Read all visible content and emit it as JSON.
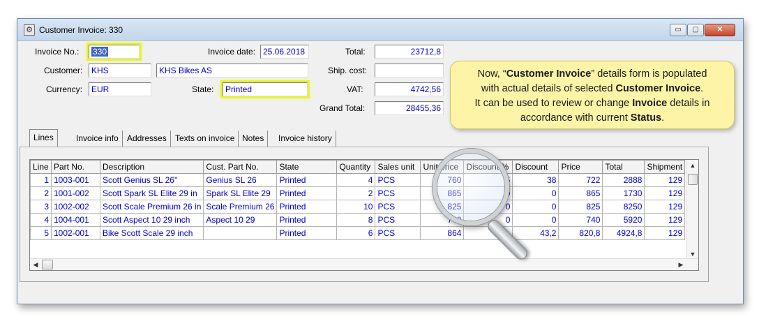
{
  "window": {
    "title": "Customer Invoice: 330",
    "controls": {
      "minimize": "▭",
      "maximize": "▢",
      "close": "✕"
    }
  },
  "header": {
    "invoice_no_label": "Invoice No.:",
    "invoice_no": "330",
    "invoice_date_label": "Invoice date:",
    "invoice_date": "25.06.2018",
    "customer_label": "Customer:",
    "customer_code": "KHS",
    "customer_name": "KHS Bikes AS",
    "currency_label": "Currency:",
    "currency": "EUR",
    "state_label": "State:",
    "state": "Printed",
    "total_label": "Total:",
    "total": "23712,8",
    "ship_cost_label": "Ship. cost:",
    "ship_cost": "",
    "vat_label": "VAT:",
    "vat": "4742,56",
    "grand_total_label": "Grand Total:",
    "grand_total": "28455,36"
  },
  "callout": {
    "line1_pre": "Now, “",
    "line1_bold": "Customer Invoice",
    "line1_post": "” details form is populated",
    "line2_pre": "with actual details of selected ",
    "line2_bold": "Customer Invoice",
    "line2_post": ".",
    "line3_pre": "It can be used to review or change ",
    "line3_bold": "Invoice",
    "line3_post": " details in",
    "line4_pre": "accordance with current ",
    "line4_bold": "Status",
    "line4_post": "."
  },
  "tabs": [
    "Lines",
    "Invoice info",
    "Addresses",
    "Texts on invoice",
    "Notes",
    "Invoice history"
  ],
  "table": {
    "columns": [
      "Line",
      "Part No.",
      "Description",
      "Cust. Part No.",
      "State",
      "Quantity",
      "Sales unit",
      "Unit price",
      "Discount %",
      "Discount",
      "Price",
      "Total",
      "Shipment"
    ],
    "rows": [
      [
        "1",
        "1003-001",
        "Scott Genius SL 26''",
        "Genius SL 26",
        "Printed",
        "4",
        "PCS",
        "760",
        "5",
        "38",
        "722",
        "2888",
        "129"
      ],
      [
        "2",
        "1001-002",
        "Scott Spark SL Elite 29 in",
        "Spark SL Elite 29",
        "Printed",
        "2",
        "PCS",
        "865",
        "0",
        "0",
        "865",
        "1730",
        "129"
      ],
      [
        "3",
        "1002-002",
        "Scott Scale Premium 26 in",
        "Scale Premium 26",
        "Printed",
        "10",
        "PCS",
        "825",
        "0",
        "0",
        "825",
        "8250",
        "129"
      ],
      [
        "4",
        "1004-001",
        "Scott Aspect 10 29 inch",
        "Aspect 10 29",
        "Printed",
        "8",
        "PCS",
        "740",
        "0",
        "0",
        "740",
        "5920",
        "129"
      ],
      [
        "5",
        "1002-001",
        "Bike Scott Scale 29 inch",
        "",
        "Printed",
        "6",
        "PCS",
        "864",
        "",
        "43,2",
        "820,8",
        "4924,8",
        "129"
      ]
    ]
  },
  "icons": {
    "app": "gear-icon",
    "magnifier": "magnifying-glass-icon"
  },
  "colors": {
    "field_text": "#0000cc",
    "highlight": "#e7f23a",
    "callout_bg": "#fdf4a7",
    "selection": "#3e63c9"
  }
}
